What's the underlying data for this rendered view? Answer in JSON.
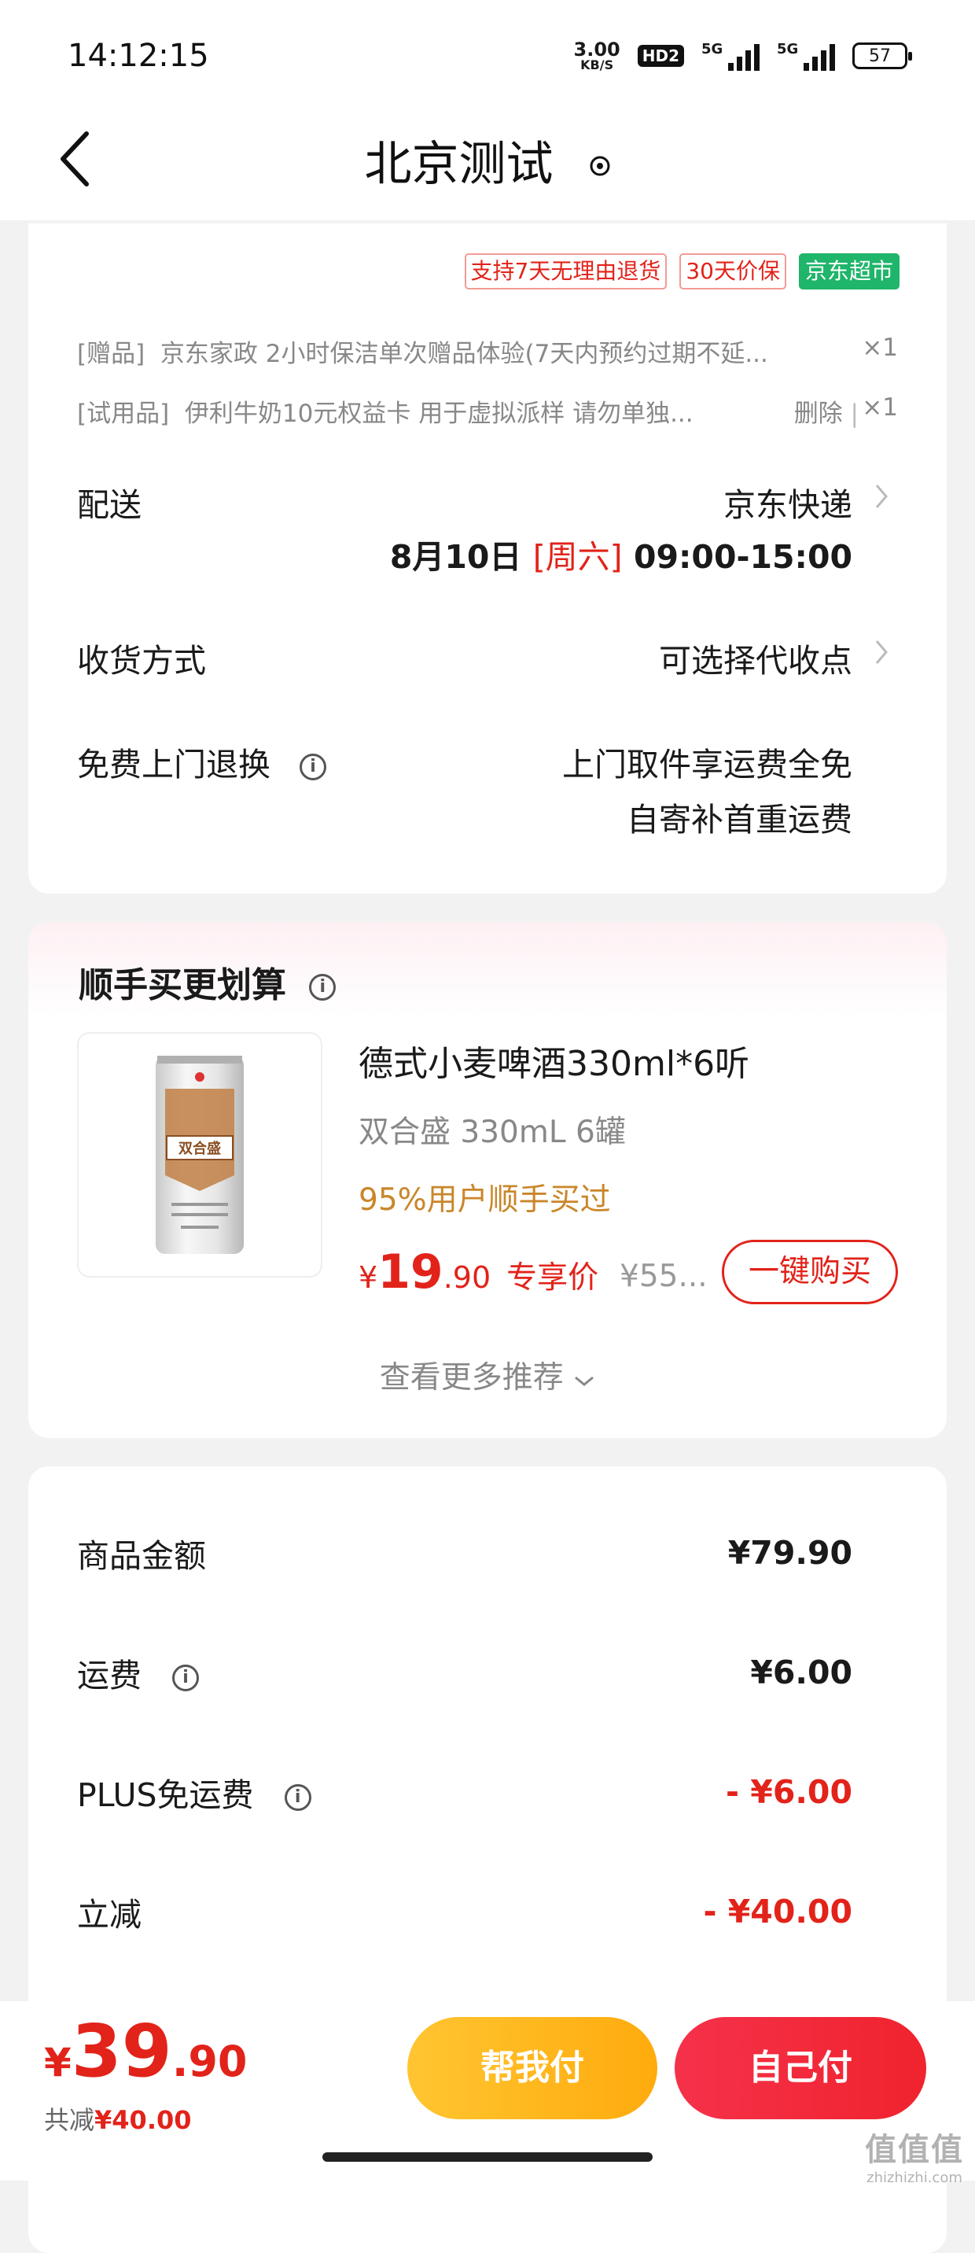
{
  "status_bar": {
    "time": "14:12:15",
    "net_speed": "3.00",
    "net_unit": "KB/S",
    "hd": "HD2",
    "sim1": "5G",
    "sim2": "5G",
    "battery": "57"
  },
  "nav": {
    "title": "北京测试",
    "back_icon": "chevron-left-icon",
    "location_icon": "location-pin-icon"
  },
  "tags": [
    "支持7天无理由退货",
    "30天价保",
    "京东超市"
  ],
  "gifts": [
    {
      "label": "[赠品]",
      "text": "京东家政 2小时保洁单次赠品体验(7天内预约过期不延...",
      "qty": "×1"
    },
    {
      "label": "[试用品]",
      "text": "伊利牛奶10元权益卡 用于虚拟派样 请勿单独...",
      "action": "删除",
      "qty": "×1"
    }
  ],
  "delivery": {
    "label": "配送",
    "carrier": "京东快递",
    "date": "8月10日",
    "weekday": "[周六]",
    "time_range": "09:00-15:00"
  },
  "receive": {
    "label": "收货方式",
    "value": "可选择代收点"
  },
  "return": {
    "label": "免费上门退换",
    "value_line1": "上门取件享运费全免",
    "value_line2": "自寄补首重运费"
  },
  "recommend": {
    "title": "顺手买更划算",
    "product_name": "德式小麦啤酒330ml*6听",
    "spec": "双合盛 330mL 6罐",
    "popularity": "95%用户顺手买过",
    "price_symbol": "¥",
    "price_int": "19",
    "price_dec": ".90",
    "price_tag": "专享价",
    "orig_price": "¥55...",
    "buy_label": "一键购买",
    "more_label": "查看更多推荐",
    "can_brand": "双合盛"
  },
  "amounts": [
    {
      "label": "商品金额",
      "value": "¥79.90",
      "info": false,
      "red": false
    },
    {
      "label": "运费",
      "value": "¥6.00",
      "info": true,
      "red": false
    },
    {
      "label": "PLUS免运费",
      "value": "- ¥6.00",
      "info": true,
      "red": true
    },
    {
      "label": "立减",
      "value": "- ¥40.00",
      "info": false,
      "red": true
    }
  ],
  "bottom": {
    "total_symbol": "¥",
    "total_int": "39",
    "total_dec": ".90",
    "saved_label": "共减",
    "saved_value": "¥40.00",
    "help_pay": "帮我付",
    "self_pay": "自己付"
  },
  "watermark": {
    "text": "值值值",
    "url": "zhizhizhi.com"
  },
  "colors": {
    "accent_red": "#e2231a",
    "green_tag": "#1fb56a",
    "yellow_btn": "#ffab0d",
    "red_btn": "#f0232e",
    "orange_text": "#c9862a"
  }
}
